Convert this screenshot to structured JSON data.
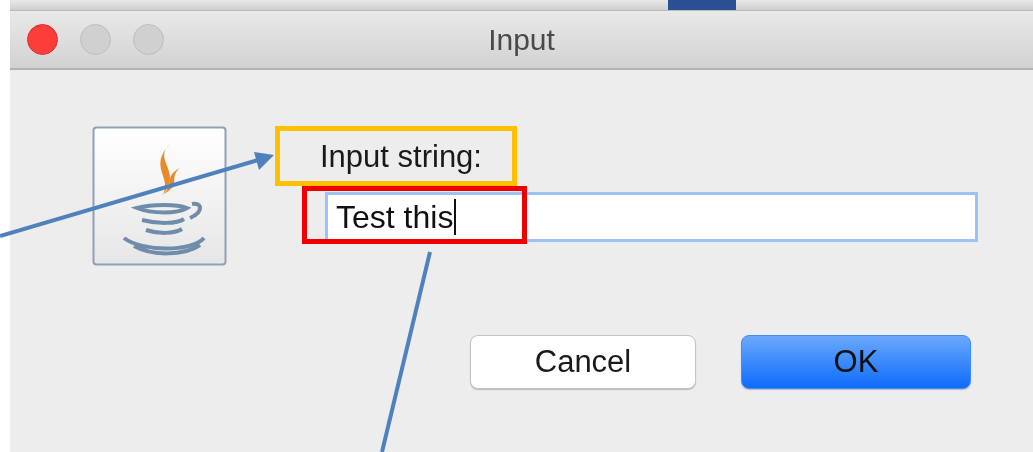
{
  "window": {
    "title": "Input"
  },
  "prompt": {
    "text": "Input string:",
    "color": "#ffc000"
  },
  "field": {
    "value": "Test this",
    "focused": true,
    "color": "#ee0000"
  },
  "buttons": [
    {
      "label": "Cancel",
      "default": false
    },
    {
      "label": "OK",
      "default": true
    }
  ]
}
